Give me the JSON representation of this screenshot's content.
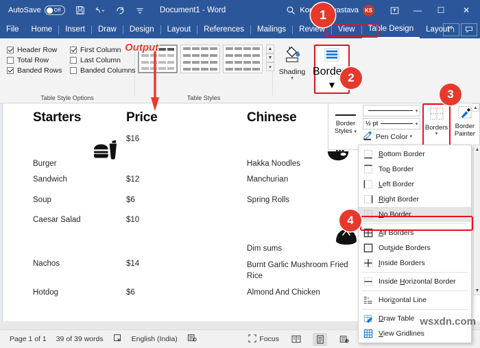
{
  "titlebar": {
    "autosave_label": "AutoSave",
    "autosave_state": "Off",
    "save_icon": "save-icon",
    "undo_icon": "undo-icon",
    "redo_icon": "redo-icon",
    "customize_icon": "customize-quick-access-icon",
    "document_title": "Document1  -  Word",
    "search_icon": "search-icon",
    "user_name": "Komal Srivastava",
    "avatar_initials": "KS",
    "ribbon_display_icon": "ribbon-display-options-icon",
    "minimize_label": "—",
    "maximize_label": "☐",
    "close_label": "✕"
  },
  "tabs": [
    "File",
    "Home",
    "Insert",
    "Draw",
    "Design",
    "Layout",
    "References",
    "Mailings",
    "Review",
    "View",
    "Table Design",
    "Layout"
  ],
  "active_tab": "Table Design",
  "tabbar_right": {
    "share_icon": "share-icon",
    "comments_icon": "comments-icon"
  },
  "ribbon": {
    "table_style_options": {
      "group_title": "Table Style Options",
      "checkboxes": [
        {
          "label": "Header Row",
          "checked": true
        },
        {
          "label": "First Column",
          "checked": true
        },
        {
          "label": "Total Row",
          "checked": false
        },
        {
          "label": "Last Column",
          "checked": false
        },
        {
          "label": "Banded Rows",
          "checked": true
        },
        {
          "label": "Banded Columns",
          "checked": false
        }
      ]
    },
    "table_styles": {
      "group_title": "Table Styles",
      "scroll_up_icon": "scroll-up-icon",
      "scroll_down_icon": "scroll-down-icon",
      "more_icon": "more-styles-icon"
    },
    "shading": {
      "label": "Shading",
      "icon": "shading-paint-bucket-icon",
      "dropdown_icon": "chevron-down-icon"
    },
    "borders_button": {
      "label": "Borders",
      "icon": "borders-icon",
      "dropdown_icon": "chevron-down-icon"
    }
  },
  "borders_panel": {
    "border_styles": {
      "label_line1": "Border",
      "label_line2": "Styles",
      "dropdown_icon": "chevron-down-icon"
    },
    "line_style_combo": {
      "value": "",
      "dropdown_icon": "chevron-down-icon"
    },
    "line_weight_combo": {
      "value": "½ pt",
      "dropdown_icon": "chevron-down-icon"
    },
    "pen_color": {
      "label": "Pen Color",
      "icon": "pen-color-icon",
      "dropdown_icon": "chevron-down-icon"
    },
    "borders": {
      "label": "Borders",
      "icon": "borders-grid-icon",
      "dropdown_icon": "chevron-down-icon"
    },
    "border_painter": {
      "label_line1": "Border",
      "label_line2": "Painter",
      "icon": "border-painter-icon"
    },
    "scroll_up_icon": "scroll-up-icon",
    "scroll_down_icon": "scroll-down-icon"
  },
  "borders_menu": {
    "items": [
      {
        "label": "Bottom Border",
        "accel": "B",
        "icon": "bottom-border-icon",
        "highlighted": false
      },
      {
        "label": "Top Border",
        "accel": "p",
        "icon": "top-border-icon",
        "highlighted": false
      },
      {
        "label": "Left Border",
        "accel": "L",
        "icon": "left-border-icon",
        "highlighted": false
      },
      {
        "label": "Right Border",
        "accel": "R",
        "icon": "right-border-icon",
        "highlighted": false
      },
      {
        "label": "No Border",
        "accel": "N",
        "icon": "no-border-icon",
        "highlighted": true
      },
      {
        "label": "All Borders",
        "accel": "A",
        "icon": "all-borders-icon",
        "highlighted": false
      },
      {
        "label": "Outside Borders",
        "accel": "s",
        "icon": "outside-borders-icon",
        "highlighted": false
      },
      {
        "label": "Inside Borders",
        "accel": "I",
        "icon": "inside-borders-icon",
        "highlighted": false
      },
      {
        "label": "Inside Horizontal Border",
        "accel": "H",
        "icon": "inside-horizontal-border-icon",
        "highlighted": false
      },
      {
        "label": "Horizontal Line",
        "accel": "z",
        "icon": "horizontal-line-icon",
        "highlighted": false
      },
      {
        "label": "Draw Table",
        "accel": "D",
        "icon": "draw-table-icon",
        "highlighted": false
      },
      {
        "label": "View Gridlines",
        "accel": "V",
        "icon": "view-gridlines-icon",
        "highlighted": false
      }
    ]
  },
  "document": {
    "headers": [
      "Starters",
      "Price",
      "Chinese"
    ],
    "rows": [
      {
        "starter": "Burger",
        "price": "$16",
        "chinese": "Hakka Noodles",
        "starter_icon": "burger-meal-icon",
        "chinese_icon": "noodle-bowl-icon"
      },
      {
        "starter": "Sandwich",
        "price": "$12",
        "chinese": "Manchurian",
        "starter_icon": "",
        "chinese_icon": ""
      },
      {
        "starter": "Soup",
        "price": "$6",
        "chinese": "Spring Rolls",
        "starter_icon": "",
        "chinese_icon": ""
      },
      {
        "starter": "Caesar Salad",
        "price": "$10",
        "chinese": "Dim sums",
        "starter_icon": "",
        "chinese_icon": "dumpling-icon"
      },
      {
        "starter": "Nachos",
        "price": "$14",
        "chinese": "Burnt Garlic Mushroom Fried Rice",
        "starter_icon": "",
        "chinese_icon": ""
      },
      {
        "starter": "Hotdog",
        "price": "$6",
        "chinese": "Almond And Chicken",
        "starter_icon": "",
        "chinese_icon": ""
      }
    ]
  },
  "status_bar": {
    "page": "Page 1 of 1",
    "words": "39 of 39 words",
    "proofing_icon": "proofing-errors-icon",
    "language": "English (India)",
    "accessibility_icon": "accessibility-icon",
    "focus_label": "Focus",
    "focus_icon": "focus-icon",
    "read_mode_icon": "read-mode-icon",
    "print_layout_icon": "print-layout-icon",
    "web_layout_icon": "web-layout-icon"
  },
  "annotations": {
    "output_label": "Output",
    "badges": [
      "1",
      "2",
      "3",
      "4"
    ],
    "watermark": "wsxdn.com"
  },
  "colors": {
    "word_blue": "#2b579a",
    "accent_red": "#e8382c",
    "highlight_red": "#e81123",
    "ribbon_bg": "#f3f3f3",
    "avatar_bg": "#c0392b"
  }
}
